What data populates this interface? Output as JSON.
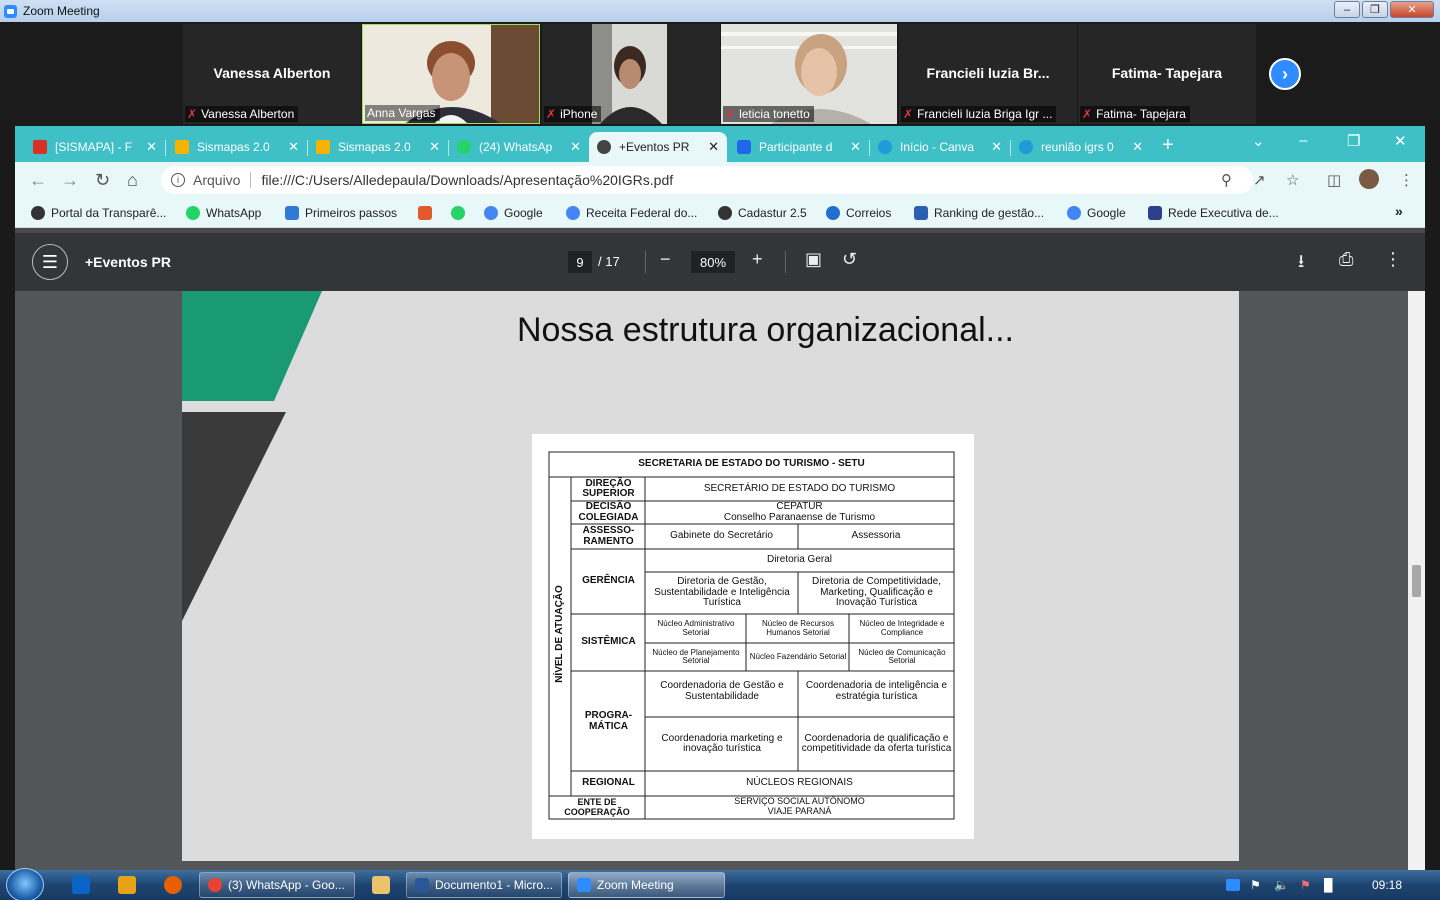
{
  "zoom": {
    "title": "Zoom Meeting",
    "participants": [
      {
        "name": "Vanessa Alberton",
        "label": "Vanessa Alberton",
        "video": false
      },
      {
        "name": "Anna Vargas",
        "label": "Anna Vargas",
        "video": true
      },
      {
        "name": "iPhone",
        "label": "iPhone",
        "video": true
      },
      {
        "name": "leticia tonetto",
        "label": "leticia tonetto",
        "video": true
      },
      {
        "name": "Francieli luzia Br...",
        "label": "Francieli luzia Briga Igr ...",
        "video": false
      },
      {
        "name": "Fatima- Tapejara",
        "label": "Fatima- Tapejara",
        "video": false
      }
    ],
    "next_icon": "chevron-right-icon"
  },
  "browser": {
    "tabs": [
      {
        "label": "[SISMAPA] - F",
        "icon": "gmail-icon",
        "color": "#d93025",
        "active": false
      },
      {
        "label": "Sismapas 2.0",
        "icon": "drive-icon",
        "color": "#f4b400",
        "active": false
      },
      {
        "label": "Sismapas 2.0",
        "icon": "drive-icon",
        "color": "#f4b400",
        "active": false
      },
      {
        "label": "(24) WhatsAp",
        "icon": "whatsapp-icon",
        "color": "#25d366",
        "active": false
      },
      {
        "label": "+Eventos PR",
        "icon": "globe-icon",
        "color": "#444444",
        "active": true
      },
      {
        "label": "Participante d",
        "icon": "zoho-icon",
        "color": "#2166e8",
        "active": false
      },
      {
        "label": "Início - Canva",
        "icon": "canva-icon",
        "color": "#1f9bd7",
        "active": false
      },
      {
        "label": "reunião igrs 0",
        "icon": "canva-icon",
        "color": "#1f9bd7",
        "active": false
      }
    ],
    "address_label": "Arquivo",
    "url": "file:///C:/Users/Alledepaula/Downloads/Apresentação%20IGRs.pdf",
    "bookmarks": [
      {
        "label": "Portal da Transparê...",
        "color": "#333333"
      },
      {
        "label": "WhatsApp",
        "color": "#25d366"
      },
      {
        "label": "Primeiros passos",
        "color": "#2d7bd6"
      },
      {
        "label": "",
        "color": "#e05a2b"
      },
      {
        "label": "",
        "color": "#25d366"
      },
      {
        "label": "Google",
        "color": "#4285f4"
      },
      {
        "label": "Receita Federal do...",
        "color": "#4285f4"
      },
      {
        "label": "Cadastur 2.5",
        "color": "#333333"
      },
      {
        "label": "Correios",
        "color": "#1f6fd1"
      },
      {
        "label": "Ranking de gestão...",
        "color": "#2b5fb4"
      },
      {
        "label": "Google",
        "color": "#4285f4"
      },
      {
        "label": "Rede Executiva de...",
        "color": "#2b3f8c"
      }
    ],
    "bookmarks_more": "»"
  },
  "pdf": {
    "doc_title": "+Eventos PR",
    "page": "9",
    "page_total": "/ 17",
    "zoom": "80%",
    "slide_title": "Nossa estrutura organizacional...",
    "org": {
      "header": "SECRETARIA DE ESTADO DO TURISMO - SETU",
      "side_label": "NÍVEL DE ATUAÇÃO",
      "direcao": "DIREÇÃO SUPERIOR",
      "direcao_val": "SECRETÁRIO DE ESTADO DO TURISMO",
      "decisao": "DECISÃO COLEGIADA",
      "decisao_val1": "CEPATUR",
      "decisao_val2": "Conselho Paranaense de Turismo",
      "assess": "ASSESSO-RAMENTO",
      "assess_a": "Gabinete do Secretário",
      "assess_b": "Assessoria",
      "gerencia": "GERÊNCIA",
      "diretoria_geral": "Diretoria Geral",
      "dir_a": "Diretoria de Gestão, Sustentabilidade e Inteligência Turística",
      "dir_b": "Diretoria de Competitividade, Marketing, Qualificação e Inovação Turística",
      "sistemica": "SISTÊMICA",
      "nucleos": [
        "Núcleo Administrativo Setorial",
        "Núcleo de Recursos Humanos Setorial",
        "Núcleo de Integridade e Compliance",
        "Núcleo de Planejamento Setorial",
        "Núcleo Fazendário Setorial",
        "Núcleo de Comunicação Setorial"
      ],
      "programatica": "PROGRA-MÁTICA",
      "coords": [
        "Coordenadoria de Gestão e Sustentabilidade",
        "Coordenadoria de inteligência e estratégia turística",
        "Coordenadoria marketing e inovação turística",
        "Coordenadoria de qualificação e competitividade da oferta turística"
      ],
      "regional": "REGIONAL",
      "regional_val": "NÚCLEOS REGIONAIS",
      "ente": "ENTE DE COOPERAÇÃO",
      "ente_val1": "SERVIÇO SOCIAL AUTÔNOMO",
      "ente_val2": "VIAJE PARANÁ"
    }
  },
  "taskbar": {
    "buttons": [
      {
        "label": "(3) WhatsApp - Goo...",
        "color": "#e94235"
      },
      {
        "label": "Documento1 - Micro...",
        "color": "#2b579a"
      },
      {
        "label": "Zoom Meeting",
        "color": "#2d8cff"
      }
    ],
    "clock": "09:18"
  }
}
